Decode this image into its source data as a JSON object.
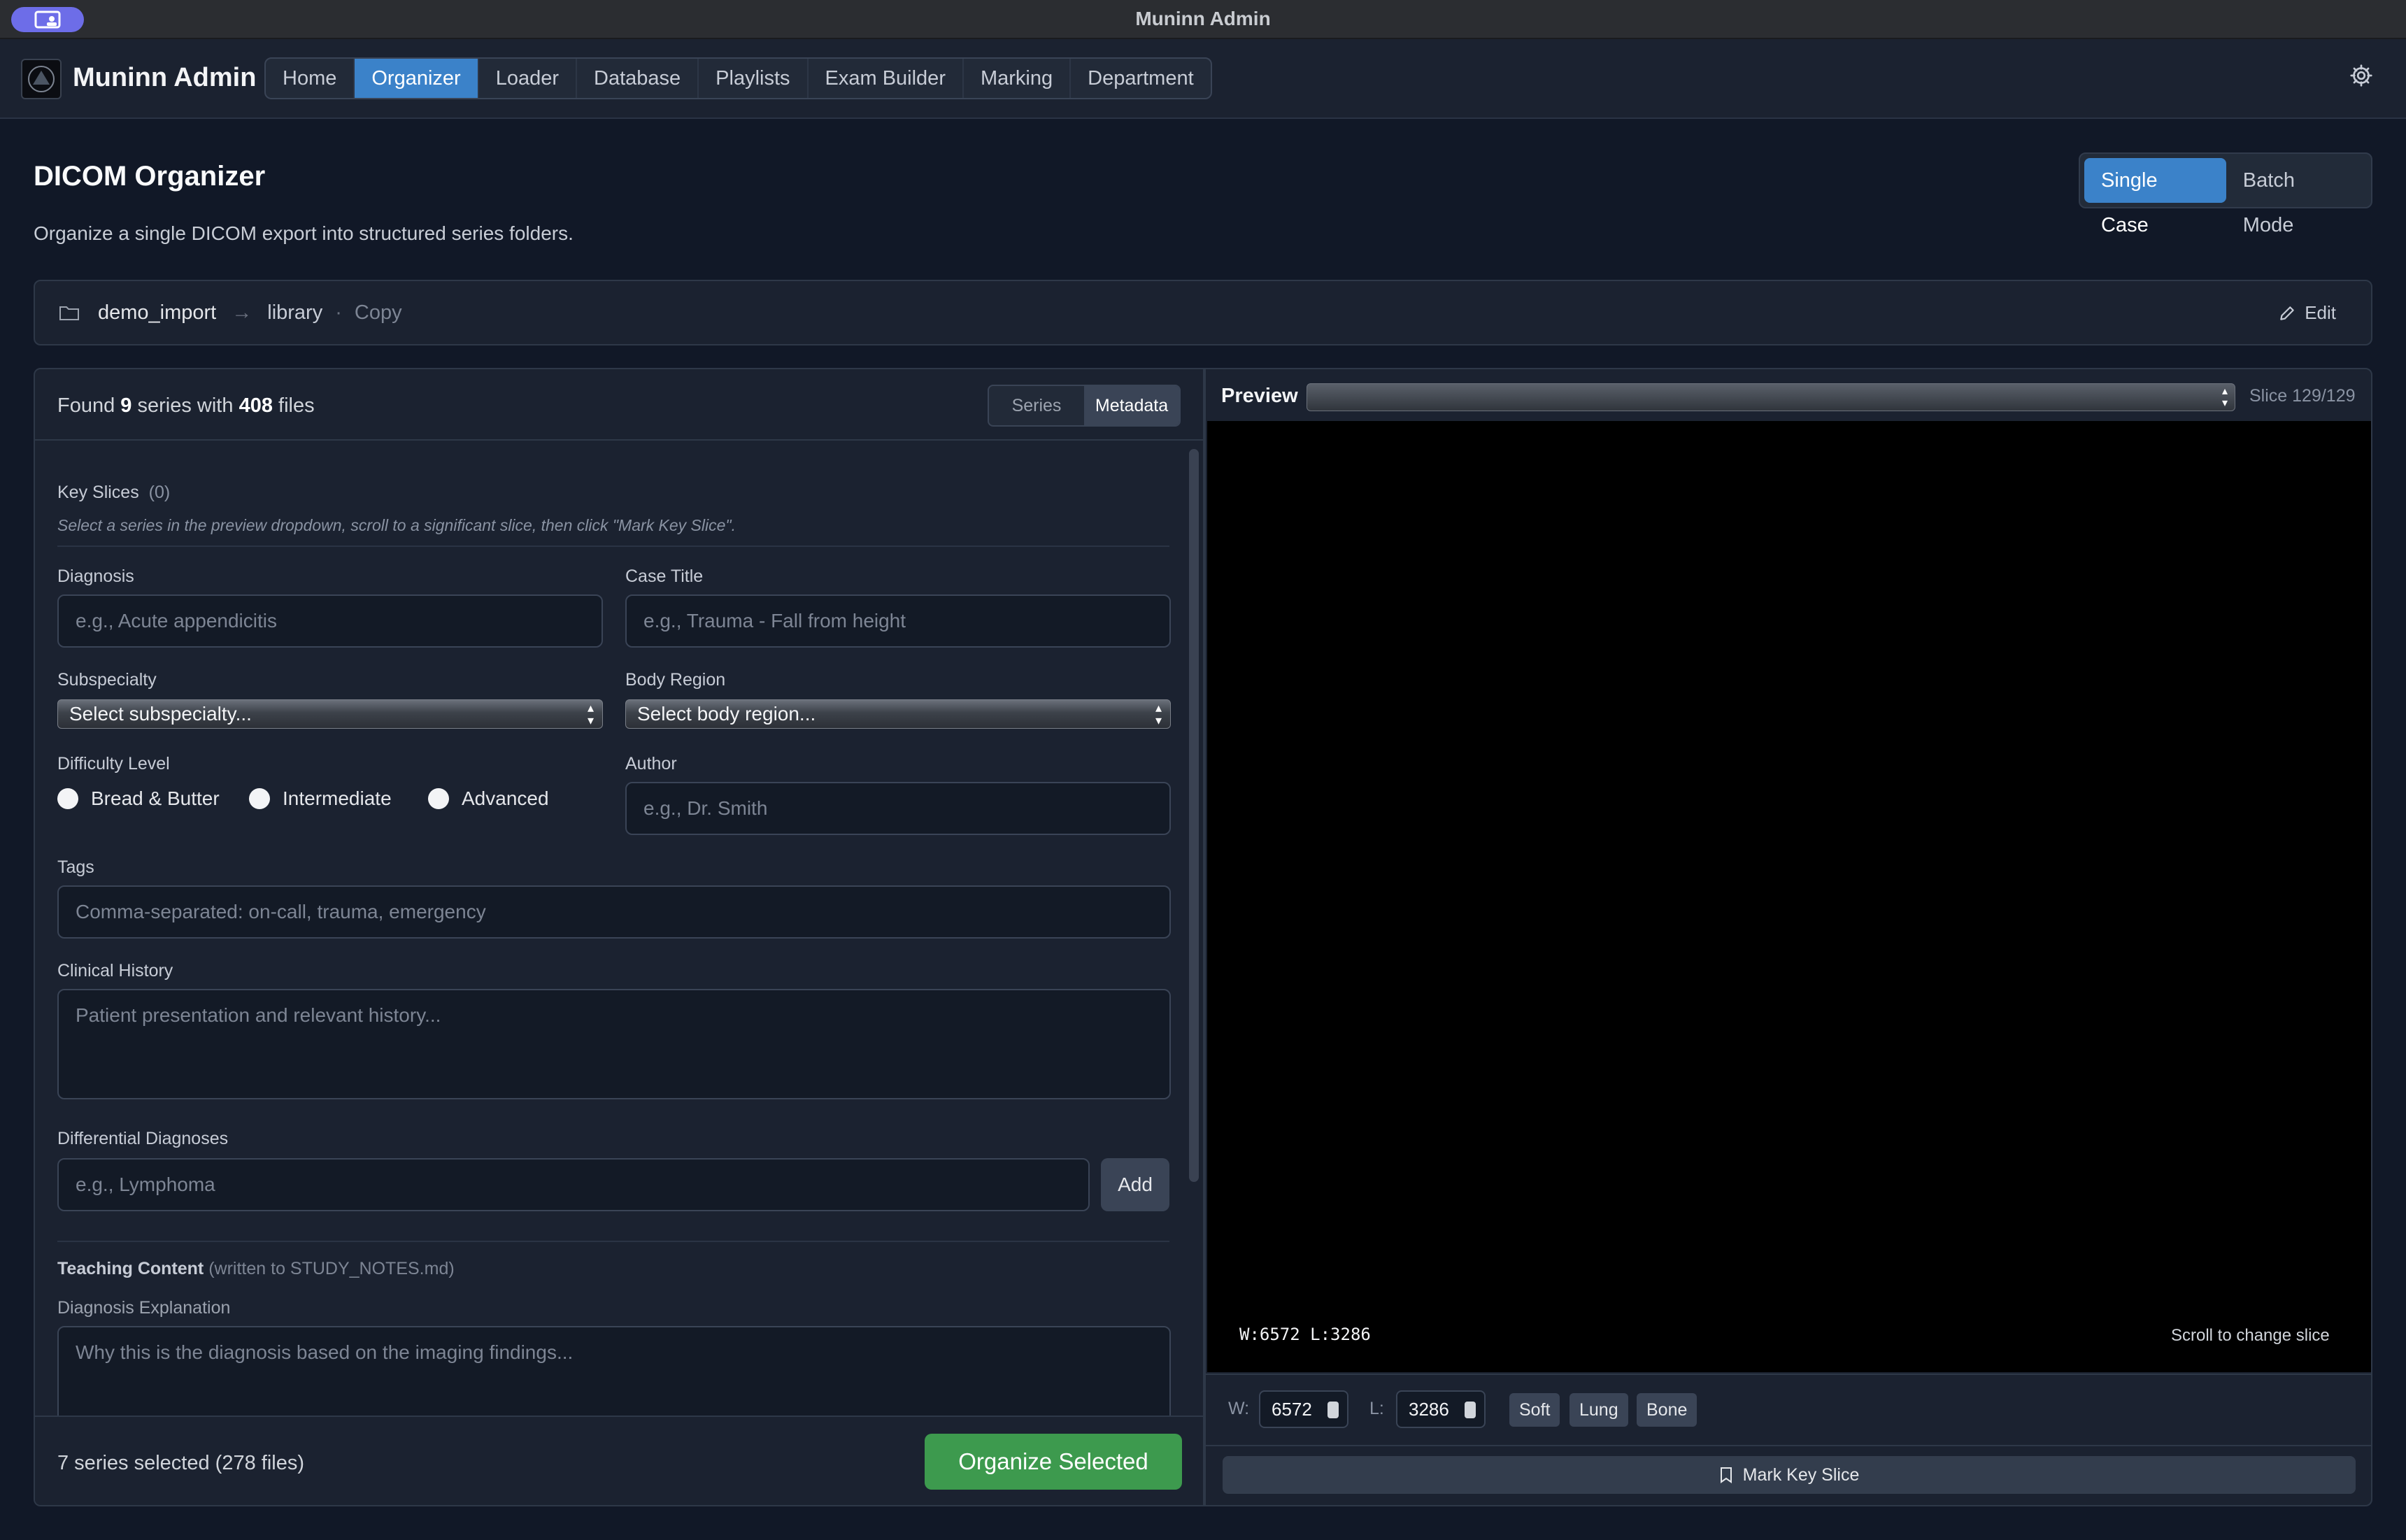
{
  "window": {
    "title": "Muninn Admin"
  },
  "app": {
    "name": "Muninn Admin"
  },
  "nav": {
    "items": [
      "Home",
      "Organizer",
      "Loader",
      "Database",
      "Playlists",
      "Exam Builder",
      "Marking",
      "Department"
    ],
    "active": "Organizer"
  },
  "page": {
    "title": "DICOM Organizer",
    "subtitle": "Organize a single DICOM export into structured series folders."
  },
  "mode_toggle": {
    "single": "Single Case",
    "batch": "Batch Mode",
    "active": "Single Case"
  },
  "pathbar": {
    "source": "demo_import",
    "arrow": "→",
    "destination": "library",
    "separator": "·",
    "mode": "Copy",
    "edit_label": "Edit"
  },
  "summary": {
    "prefix": "Found",
    "series_count": "9",
    "middle": "series with",
    "file_count": "408",
    "suffix": "files"
  },
  "tabs": {
    "series": "Series",
    "metadata": "Metadata",
    "active": "Metadata"
  },
  "form": {
    "key_slices": {
      "label": "Key Slices",
      "count": "(0)",
      "hint": "Select a series in the preview dropdown, scroll to a significant slice, then click \"Mark Key Slice\"."
    },
    "diagnosis": {
      "label": "Diagnosis",
      "placeholder": "e.g., Acute appendicitis"
    },
    "case_title": {
      "label": "Case Title",
      "placeholder": "e.g., Trauma - Fall from height"
    },
    "subspecialty": {
      "label": "Subspecialty",
      "value": "Select subspecialty..."
    },
    "body_region": {
      "label": "Body Region",
      "value": "Select body region..."
    },
    "difficulty": {
      "label": "Difficulty Level",
      "options": [
        "Bread & Butter",
        "Intermediate",
        "Advanced"
      ]
    },
    "author": {
      "label": "Author",
      "placeholder": "e.g., Dr. Smith"
    },
    "tags": {
      "label": "Tags",
      "placeholder": "Comma-separated: on-call, trauma, emergency"
    },
    "clinical_history": {
      "label": "Clinical History",
      "placeholder": "Patient presentation and relevant history..."
    },
    "differentials": {
      "label": "Differential Diagnoses",
      "placeholder": "e.g., Lymphoma",
      "add_label": "Add"
    },
    "teaching": {
      "label": "Teaching Content",
      "note": "(written to STUDY_NOTES.md)"
    },
    "diagnosis_explanation": {
      "label": "Diagnosis Explanation",
      "placeholder": "Why this is the diagnosis based on the imaging findings..."
    }
  },
  "footer": {
    "selected": "7 series selected (278 files)",
    "organize_label": "Organize Selected"
  },
  "preview": {
    "label": "Preview",
    "slice": "Slice 129/129",
    "overlay_wl": "W:6572 L:3286",
    "scroll_hint": "Scroll to change slice",
    "w_label": "W:",
    "w_value": "6572",
    "l_label": "L:",
    "l_value": "3286",
    "presets": [
      "Soft",
      "Lung",
      "Bone"
    ],
    "mark_label": "Mark Key Slice"
  },
  "colors": {
    "accent": "#3b82c9",
    "success": "#3d9a4e",
    "background": "#111827",
    "panel": "#1b2230"
  },
  "icons": {
    "folder": "folder-icon",
    "edit": "pencil-icon",
    "settings": "gear-icon",
    "bookmark": "bookmark-icon"
  }
}
